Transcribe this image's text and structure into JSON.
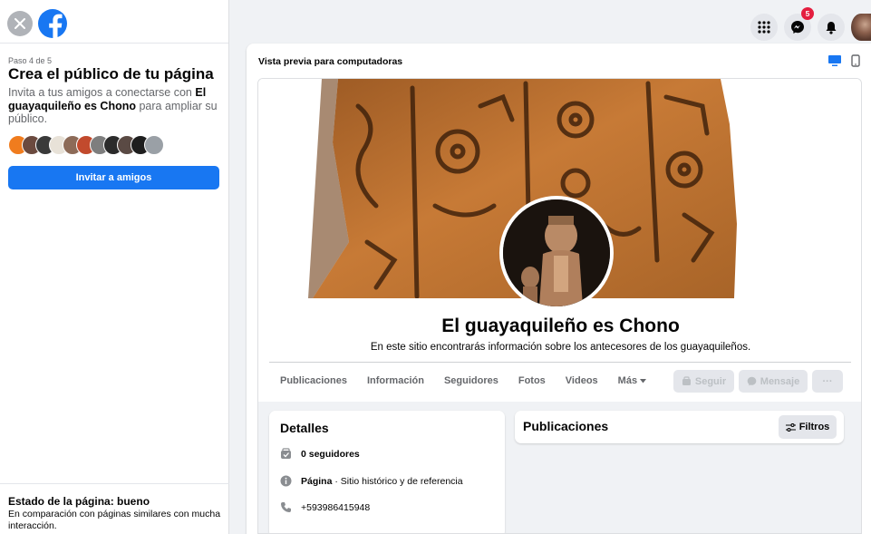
{
  "wizard": {
    "step": "Paso 4 de 5",
    "title": "Crea el público de tu página",
    "desc_start": "Invita a tus amigos a conectarse con ",
    "desc_page": "El guayaquileño es Chono",
    "desc_end": " para ampliar su público.",
    "invite_button": "Invitar a amigos"
  },
  "page_status": {
    "title": "Estado de la página: bueno",
    "desc": "En comparación con páginas similares con mucha interacción."
  },
  "topbar": {
    "messenger_badge": "5",
    "icons": [
      "menu-grid-icon",
      "messenger-icon",
      "bell-icon"
    ]
  },
  "preview": {
    "label": "Vista previa para computadoras",
    "page_name": "El guayaquileño es Chono",
    "page_desc": "En este sitio encontrarás información sobre los antecesores de los guayaquileños.",
    "tabs": [
      "Publicaciones",
      "Información",
      "Seguidores",
      "Fotos",
      "Videos",
      "Más"
    ],
    "follow_button": "Seguir",
    "message_button": "Mensaje",
    "more_button": "···",
    "details": {
      "title": "Detalles",
      "followers": "0 seguidores",
      "category_label": "Página",
      "category_value": " · Sitio histórico y de referencia",
      "phone": "+593986415948"
    },
    "posts": {
      "title": "Publicaciones",
      "filter_button": "Filtros"
    }
  },
  "colors": {
    "primary": "#1877f2",
    "background": "#f0f2f5",
    "badge": "#e41e3f"
  }
}
